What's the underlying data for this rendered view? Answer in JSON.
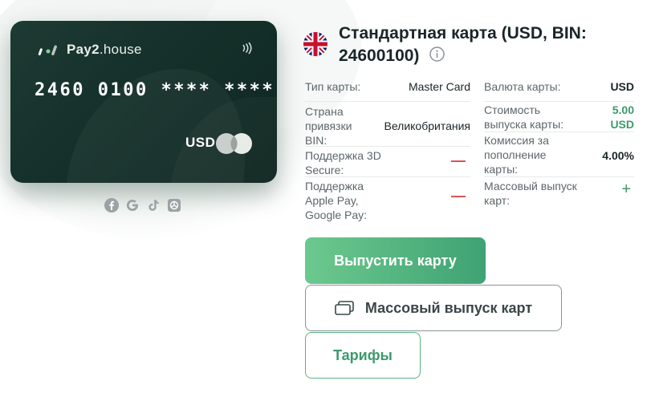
{
  "card": {
    "brand_name": "Pay2",
    "brand_suffix": ".house",
    "number": "2460 0100 **** ****",
    "currency": "USD"
  },
  "socials": [
    {
      "icon": "facebook-icon"
    },
    {
      "icon": "google-icon"
    },
    {
      "icon": "tiktok-icon"
    },
    {
      "icon": "openai-icon"
    }
  ],
  "header": {
    "flag": "uk-flag-icon",
    "title": "Стандартная карта (USD, BIN: 24600100)"
  },
  "details_left": [
    {
      "label": "Тип карты:",
      "value": "Master Card"
    },
    {
      "label": "Страна привязки BIN:",
      "value": "Великобритания"
    },
    {
      "label": "Поддержка 3D Secure:",
      "value": "—"
    },
    {
      "label": "Поддержка Apple Pay, Google Pay:",
      "value": "—"
    }
  ],
  "details_right": [
    {
      "label": "Валюта карты:",
      "value": "USD"
    },
    {
      "label": "Стоимость выпуска карты:",
      "value": "5.00 USD"
    },
    {
      "label": "Комиссия за пополнение карты:",
      "value": "4.00%"
    },
    {
      "label": "Массовый выпуск карт:",
      "value": "+"
    }
  ],
  "buttons": {
    "issue": "Выпустить карту",
    "mass_issue": "Массовый выпуск карт",
    "tariffs": "Тарифы"
  },
  "colors": {
    "accent_green": "#3c9a6c",
    "card_dark": "#15302a",
    "negative_red": "#d94a4a"
  }
}
